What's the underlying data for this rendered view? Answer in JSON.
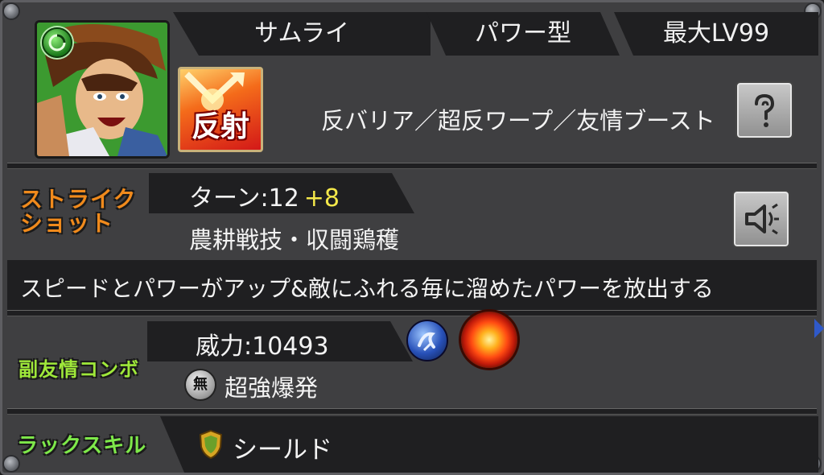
{
  "header": {
    "tribe": "サムライ",
    "type": "パワー型",
    "max_level": "最大LV99"
  },
  "portrait": {
    "icon": "samurai-character-portrait",
    "element": "wood-element-badge"
  },
  "movement_badge": {
    "label": "反射"
  },
  "abilities": "反バリア／超反ワープ／友情ブースト",
  "strike_shot": {
    "label": "ストライクショット",
    "turns_label": "ターン:12",
    "turns_bonus": "+8",
    "name": "農耕戦技・収闘鶏穫",
    "description": "スピードとパワーがアップ&敵にふれる毎に溜めたパワーを放出する"
  },
  "sub_combo": {
    "label": "副友情コンボ",
    "power": "威力:10493",
    "name_prefix": "無",
    "name": "超強爆発"
  },
  "luck_skill": {
    "label": "ラックスキル",
    "name": "シールド"
  },
  "colors": {
    "panel": "#3f3f41",
    "dark_box": "#1f1f21",
    "bonus_yellow": "#f4e84a",
    "strike_label": "#f08a1c",
    "combo_label": "#9fe83a",
    "luck_label": "#7ee84a"
  }
}
